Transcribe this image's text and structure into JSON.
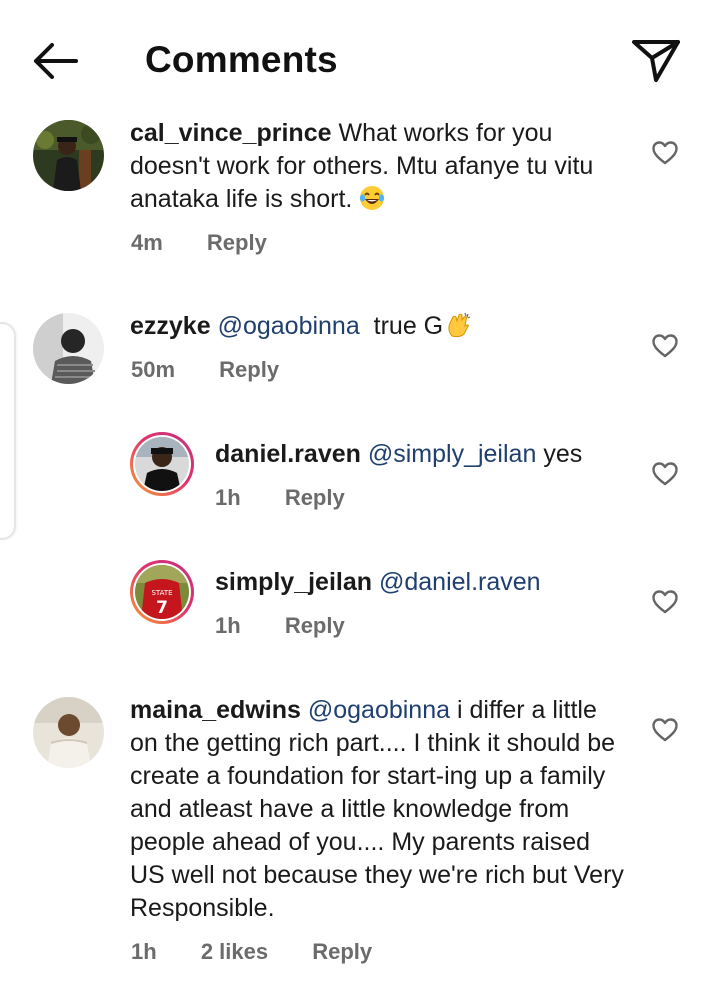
{
  "header": {
    "title": "Comments"
  },
  "comments": [
    {
      "username": "cal_vince_prince",
      "text": "What works for you doesn't work for others. Mtu afanye tu vitu anataka life is short.",
      "emoji": "laughing-tears-emoji",
      "time": "4m",
      "reply_label": "Reply"
    },
    {
      "username": "ezzyke",
      "mention": "@ogaobinna",
      "text": " true G",
      "emoji": "clapping-hands-emoji",
      "time": "50m",
      "reply_label": "Reply"
    },
    {
      "username": "daniel.raven",
      "mention": "@simply_jeilan",
      "text": "yes",
      "time": "1h",
      "reply_label": "Reply"
    },
    {
      "username": "simply_jeilan",
      "mention": "@daniel.raven",
      "text": "",
      "time": "1h",
      "reply_label": "Reply"
    },
    {
      "username": "maina_edwins",
      "mention": "@ogaobinna",
      "text": "i differ a little on the getting rich part.... I think it should be create a foundation for start-ing up a family and atleast have a little knowledge from people ahead of you.... My parents raised US well not because they we're rich but Very Responsible.",
      "time": "1h",
      "likes": "2 likes",
      "reply_label": "Reply"
    }
  ],
  "colors": {
    "mention": "#1f3f6e",
    "meta": "#6b6b6b",
    "story_ring_start": "#f9a233",
    "story_ring_end": "#c13584"
  },
  "icons": {
    "back": "arrow-left-icon",
    "send": "paper-plane-icon",
    "like": "heart-outline-icon"
  }
}
